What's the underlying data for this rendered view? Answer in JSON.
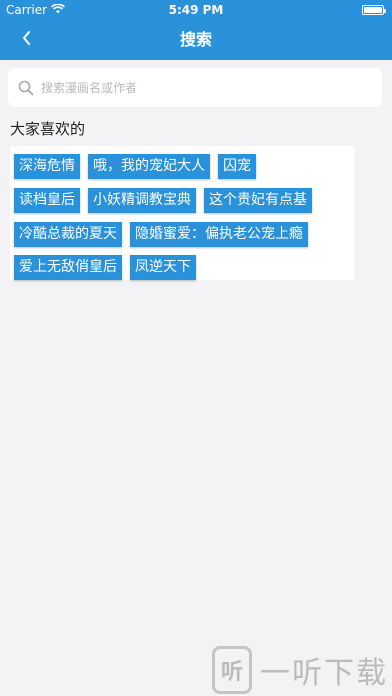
{
  "status": {
    "carrier": "Carrier",
    "time": "5:49 PM",
    "battery_level": 1.0
  },
  "nav": {
    "title": "搜索"
  },
  "search": {
    "placeholder": "搜索漫画名或作者",
    "value": ""
  },
  "favorites": {
    "title": "大家喜欢的",
    "tags": [
      [
        "深海危情",
        "哦，我的宠妃大人",
        "囚宠"
      ],
      [
        "读档皇后",
        "小妖精调教宝典",
        "这个贵妃有点基"
      ],
      [
        "冷酷总裁的夏天",
        "隐婚蜜爱：偏执老公宠上瘾"
      ],
      [
        "爱上无敌俏皇后",
        "凤逆天下"
      ]
    ]
  },
  "watermark": {
    "logo": "听",
    "text": "一听下载"
  },
  "colors": {
    "accent": "#2a92db",
    "background": "#f3f3f5"
  }
}
